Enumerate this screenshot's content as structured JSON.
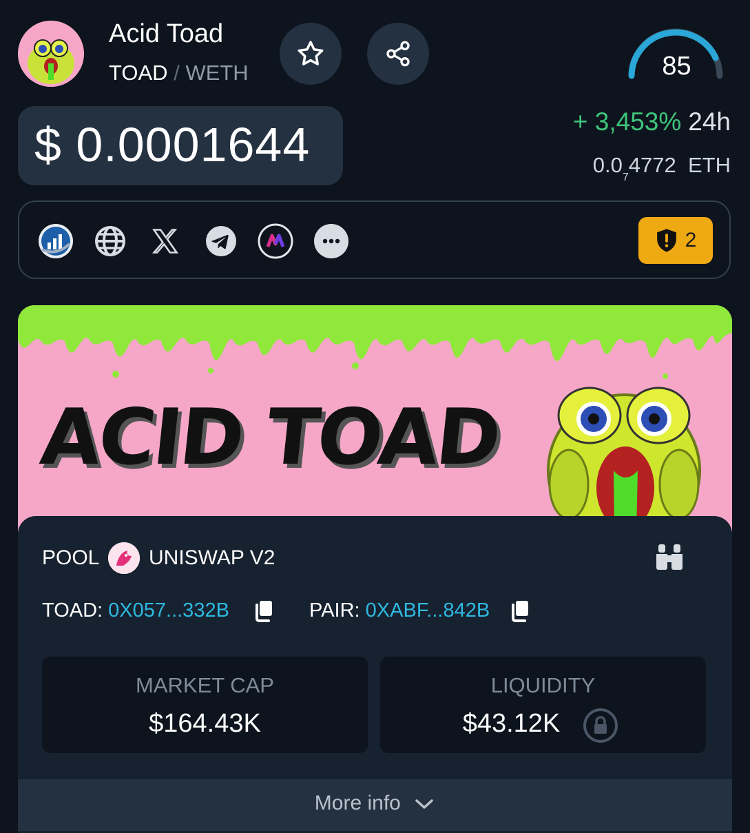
{
  "token": {
    "name": "Acid Toad",
    "base": "TOAD",
    "separator": "/",
    "quote": "WETH",
    "score": "85",
    "score_value": 85
  },
  "price": {
    "usd": "$ 0.0001644",
    "change_pct": "+ 3,453%",
    "change_period": "24h",
    "eth_prefix": "0.0",
    "eth_zeros": "7",
    "eth_digits": "4772",
    "eth_unit": "ETH"
  },
  "links": {
    "icons": [
      "dextools-icon",
      "globe-icon",
      "x-icon",
      "telegram-icon",
      "coinmarket-icon",
      "more-icon"
    ],
    "warning_count": "2"
  },
  "banner": {
    "text": "ACID TOAD"
  },
  "pool": {
    "label": "POOL",
    "dex": "UNISWAP V2",
    "token_label": "TOAD:",
    "token_address": "0X057...332B",
    "pair_label": "PAIR:",
    "pair_address": "0XABF...842B"
  },
  "stats": {
    "market_cap_label": "MARKET CAP",
    "market_cap_value": "$164.43K",
    "liquidity_label": "LIQUIDITY",
    "liquidity_value": "$43.12K"
  },
  "more": {
    "label": "More info"
  },
  "colors": {
    "background": "#0d141d",
    "card": "#172230",
    "positive": "#3fc57a",
    "link": "#2fb9e0",
    "warning": "#efa912",
    "banner": "#f6a7c8",
    "slime": "#8fe83a"
  }
}
